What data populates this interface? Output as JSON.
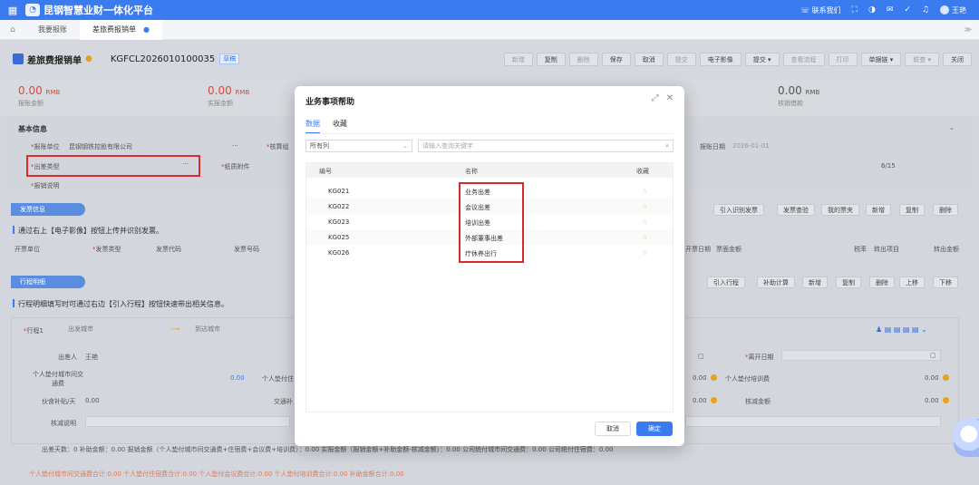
{
  "topbar": {
    "app_title": "昆钢智慧业财一体化平台",
    "contact": "联系我们",
    "user": "王艳"
  },
  "tabs": [
    {
      "label": "我要报账"
    },
    {
      "label": "差旅费报销单"
    }
  ],
  "header": {
    "doc_title": "差旅费报销单",
    "doc_no": "KGFCL2026010100035",
    "status": "草稿",
    "buttons": [
      "新增",
      "复制",
      "删除",
      "保存",
      "取消",
      "提交",
      "电子影像",
      "提交",
      "查看流程",
      "打印",
      "单据链",
      "联查",
      "关闭"
    ]
  },
  "amounts": [
    {
      "value": "0.00",
      "unit": "RMB",
      "label": "报账金额",
      "color": "red"
    },
    {
      "value": "0.00",
      "unit": "RMB",
      "label": "实报金额",
      "color": "red"
    },
    {
      "value": "0.00",
      "unit": "RMB",
      "label": "核销借款",
      "color": "gray"
    }
  ],
  "basic": {
    "title": "基本信息",
    "fields": {
      "unit_label": "报账单位",
      "unit_value": "昆钢钢铁控股有限公司",
      "approval_label": "核算组",
      "date_label": "报账日期",
      "date_value": "2026-01-01",
      "trip_type_label": "出差类型",
      "attach_label": "纸质附件",
      "counter": "6/15",
      "desc_label": "报销说明"
    }
  },
  "invoice": {
    "tab": "发票信息",
    "tip": "通过右上【电子影像】按钮上传并识别发票。",
    "buttons": [
      "引入识别发票",
      "发票查验",
      "我的票夹",
      "新增",
      "复制",
      "删除"
    ],
    "columns": [
      "开票单位",
      "发票类型",
      "发票代码",
      "发票号码",
      "开票日期",
      "票面金额",
      "税率",
      "转出项目",
      "转出金额"
    ]
  },
  "itinerary": {
    "tab": "行程明细",
    "tip": "行程明细填写时可通过右边【引入行程】按钮快速带出相关信息。",
    "buttons": [
      "引入行程",
      "补助计算",
      "新增",
      "复制",
      "删除",
      "上移",
      "下移"
    ],
    "trip_label": "行程1",
    "from_placeholder": "出发城市",
    "to_placeholder": "到达城市",
    "traveler_label": "出差人",
    "traveler_value": "王艳",
    "leave_date_label": "离开日期",
    "city_fee_label": "个人垫付城市间交通费",
    "city_fee_value": "0.00",
    "personal_label": "个人垫付住",
    "personal_value": "0.00",
    "training_label": "个人垫付培训费",
    "training_value": "0.00",
    "meal_label": "伙食补贴/天",
    "meal_value": "0.00",
    "traffic_label": "交通补",
    "traffic_value": "0.00",
    "verify_amount_label": "核减金额",
    "verify_amount_value": "0.00",
    "verify_desc_label": "核减说明",
    "summary": "出差天数：0   补助金额：0.00   报销金额（个人垫付城市间交通费+住宿费+会议费+培训费）：0.00   实报金额（报销金额+补助金额-核减金额）：0.00   公司统付城市间交通费：0.00   公司统付住宿费：0.00",
    "footer": "个人垫付城市间交通费合计:0.00  个人垫付住宿费合计:0.00  个人垫付会议费合计:0.00  个人垫付培训费合计:0.00  补助金额合计:0.00"
  },
  "modal": {
    "title": "业务事项帮助",
    "tabs": [
      "数据",
      "收藏"
    ],
    "select_value": "所有列",
    "search_placeholder": "请输入查询关键字",
    "columns": [
      "编号",
      "名称",
      "收藏"
    ],
    "rows": [
      {
        "code": "KG021",
        "name": "业务出差"
      },
      {
        "code": "KG022",
        "name": "会议出差"
      },
      {
        "code": "KG023",
        "name": "培训出差"
      },
      {
        "code": "KG025",
        "name": "外部董事出差"
      },
      {
        "code": "KG026",
        "name": "疗休养出行"
      }
    ],
    "cancel": "取消",
    "ok": "确定"
  }
}
